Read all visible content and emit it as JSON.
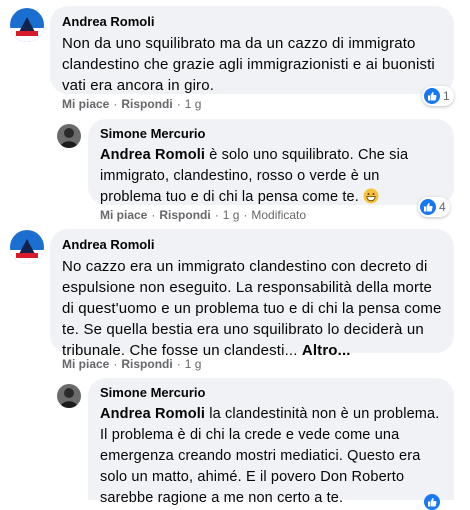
{
  "comments": [
    {
      "author": "Andrea Romoli",
      "text": "Non da uno squilibrato ma da un cazzo di immigrato clandestino che grazie agli immigrazionisti e ai buonisti vati era ancora in giro.",
      "actions": {
        "like": "Mi piace",
        "reply": "Rispondi",
        "time": "1 g"
      },
      "reaction_count": "1",
      "reply": {
        "author": "Simone Mercurio",
        "mention": "Andrea Romoli",
        "text": "è solo uno squilibrato. Che sia immigrato, clandestino, rosso o verde è un problema tuo e di chi la pensa come te.",
        "emoji": "grinning-face-emoji",
        "actions": {
          "like": "Mi piace",
          "reply": "Rispondi",
          "time": "1 g",
          "edited": "Modificato"
        },
        "reaction_count": "4"
      }
    },
    {
      "author": "Andrea Romoli",
      "text": "No cazzo era un immigrato clandestino con decreto di espulsione non eseguito. La responsabilità della morte di quest'uomo e un problema tuo e di chi la pensa come te. Se quella bestia era uno squilibrato lo deciderà un tribunale. Che fosse un clandesti...",
      "more": "Altro...",
      "actions": {
        "like": "Mi piace",
        "reply": "Rispondi",
        "time": "1 g"
      },
      "reply": {
        "author": "Simone Mercurio",
        "mention": "Andrea Romoli",
        "text": "la clandestinità non è un problema. Il problema è di chi la crede e vede come una emergenza creando mostri mediatici. Questo era solo un matto, ahimé. E il povero Don Roberto sarebbe ragione a me non certo a te."
      }
    }
  ],
  "colors": {
    "bubble": "#f0f2f5",
    "meta": "#65676b",
    "like_blue": "#1877f2"
  }
}
